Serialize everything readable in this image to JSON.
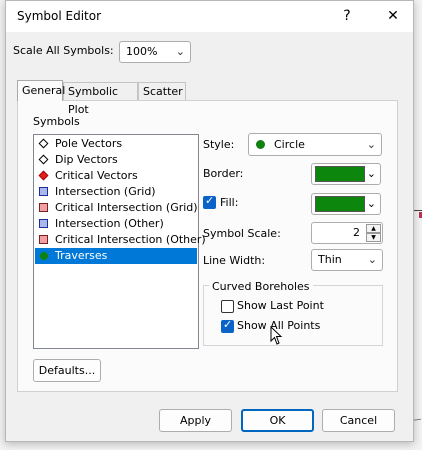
{
  "window": {
    "title": "Symbol Editor",
    "help_label": "?",
    "close_label": "✕"
  },
  "scale_all": {
    "label": "Scale All Symbols:",
    "value": "100%"
  },
  "tabs": [
    {
      "label": "General",
      "active": true
    },
    {
      "label": "Symbolic Plot",
      "active": false
    },
    {
      "label": "Scatter",
      "active": false
    }
  ],
  "symbols": {
    "group_label": "Symbols",
    "items": [
      {
        "label": "Pole Vectors",
        "marker": "diamond-open-icon"
      },
      {
        "label": "Dip Vectors",
        "marker": "diamond-open-icon"
      },
      {
        "label": "Critical Vectors",
        "marker": "diamond-red-icon"
      },
      {
        "label": "Intersection (Grid)",
        "marker": "square-blue-icon"
      },
      {
        "label": "Critical Intersection (Grid)",
        "marker": "square-red-icon"
      },
      {
        "label": "Intersection (Other)",
        "marker": "square-blue-icon"
      },
      {
        "label": "Critical Intersection (Other)",
        "marker": "square-red-icon"
      },
      {
        "label": "Traverses",
        "marker": "circle-green-icon",
        "selected": true
      }
    ]
  },
  "properties": {
    "style_label": "Style:",
    "style_value": "Circle",
    "border_label": "Border:",
    "border_color": "#0d860d",
    "fill_label": "Fill:",
    "fill_checked": true,
    "fill_color": "#0d860d",
    "symbol_scale_label": "Symbol Scale:",
    "symbol_scale_value": "2",
    "line_width_label": "Line Width:",
    "line_width_value": "Thin"
  },
  "curved_boreholes": {
    "group_label": "Curved Boreholes",
    "show_last_point_label": "Show Last Point",
    "show_last_point_checked": false,
    "show_all_points_label": "Show All Points",
    "show_all_points_checked": true
  },
  "buttons": {
    "defaults": "Defaults...",
    "apply": "Apply",
    "ok": "OK",
    "cancel": "Cancel"
  },
  "colors": {
    "accent": "#0078d7",
    "selected_bg": "#0078d7",
    "symbol_green": "#108010"
  }
}
